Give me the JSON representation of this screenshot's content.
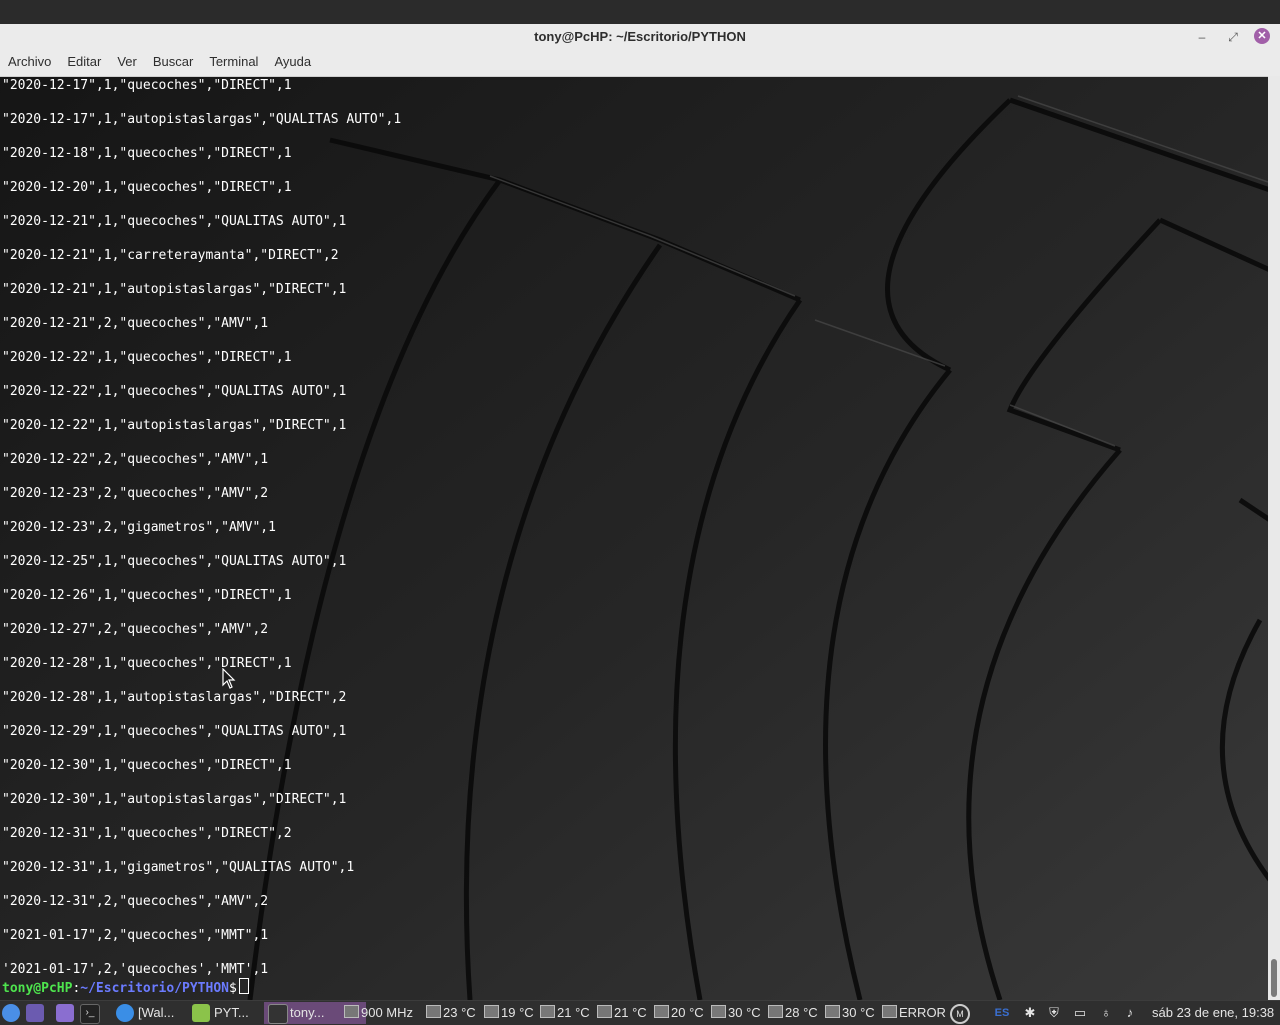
{
  "window": {
    "title": "tony@PcHP: ~/Escritorio/PYTHON",
    "controls": {
      "minimize": "–",
      "maximize": "⤢",
      "close": "✕"
    }
  },
  "menu": [
    "Archivo",
    "Editar",
    "Ver",
    "Buscar",
    "Terminal",
    "Ayuda"
  ],
  "terminal": {
    "lines": [
      "\"2020-12-17\",1,\"quecoches\",\"DIRECT\",1",
      "\"2020-12-17\",1,\"autopistaslargas\",\"QUALITAS AUTO\",1",
      "\"2020-12-18\",1,\"quecoches\",\"DIRECT\",1",
      "\"2020-12-20\",1,\"quecoches\",\"DIRECT\",1",
      "\"2020-12-21\",1,\"quecoches\",\"QUALITAS AUTO\",1",
      "\"2020-12-21\",1,\"carreteraymanta\",\"DIRECT\",2",
      "\"2020-12-21\",1,\"autopistaslargas\",\"DIRECT\",1",
      "\"2020-12-21\",2,\"quecoches\",\"AMV\",1",
      "\"2020-12-22\",1,\"quecoches\",\"DIRECT\",1",
      "\"2020-12-22\",1,\"quecoches\",\"QUALITAS AUTO\",1",
      "\"2020-12-22\",1,\"autopistaslargas\",\"DIRECT\",1",
      "\"2020-12-22\",2,\"quecoches\",\"AMV\",1",
      "\"2020-12-23\",2,\"quecoches\",\"AMV\",2",
      "\"2020-12-23\",2,\"gigametros\",\"AMV\",1",
      "\"2020-12-25\",1,\"quecoches\",\"QUALITAS AUTO\",1",
      "\"2020-12-26\",1,\"quecoches\",\"DIRECT\",1",
      "\"2020-12-27\",2,\"quecoches\",\"AMV\",2",
      "\"2020-12-28\",1,\"quecoches\",\"DIRECT\",1",
      "\"2020-12-28\",1,\"autopistaslargas\",\"DIRECT\",2",
      "\"2020-12-29\",1,\"quecoches\",\"QUALITAS AUTO\",1",
      "\"2020-12-30\",1,\"quecoches\",\"DIRECT\",1",
      "\"2020-12-30\",1,\"autopistaslargas\",\"DIRECT\",1",
      "\"2020-12-31\",1,\"quecoches\",\"DIRECT\",2",
      "\"2020-12-31\",1,\"gigametros\",\"QUALITAS AUTO\",1",
      "\"2020-12-31\",2,\"quecoches\",\"AMV\",2",
      "\"2021-01-17\",2,\"quecoches\",\"MMT\",1",
      "'2021-01-17',2,'quecoches','MMT',1"
    ],
    "prompt": {
      "user": "tony@PcHP",
      "colon": ":",
      "path": "~/Escritorio/PYTHON",
      "dollar": "$"
    }
  },
  "taskbar": {
    "tasks": [
      {
        "label": "[Wal...",
        "icon": "chrome-icon",
        "color": "#3a8ee6"
      },
      {
        "label": "PYT...",
        "icon": "folder-icon",
        "color": "#8bc34a"
      },
      {
        "label": "tony...",
        "icon": "terminal-icon",
        "color": "#333333",
        "active": true
      }
    ],
    "cpu_freq": "900 MHz",
    "sensors": [
      "23 °C",
      "19 °C",
      "21 °C",
      "21 °C",
      "20 °C",
      "30 °C",
      "28 °C",
      "30 °C",
      "ERROR"
    ],
    "keyboard_layout": "ES",
    "clock": "sáb 23 de ene, 19:38"
  },
  "colors": {
    "prompt_user": "#4ee44e",
    "prompt_path": "#6b7bff",
    "active_task": "#6a4a78",
    "close_button": "#a15fa8"
  }
}
